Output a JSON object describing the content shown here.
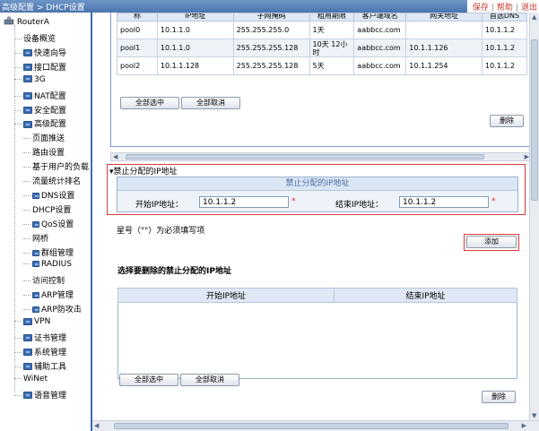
{
  "header": {
    "breadcrumb": "高级配置 > DHCP设置",
    "links": [
      "保存",
      "帮助",
      "退出"
    ]
  },
  "sidebar": {
    "root": "RouterA",
    "items": [
      {
        "label": "设备概览",
        "level": 1,
        "folder": false
      },
      {
        "label": "快速向导",
        "level": 1,
        "folder": true
      },
      {
        "label": "接口配置",
        "level": 1,
        "folder": true
      },
      {
        "label": "3G",
        "level": 1,
        "folder": true
      },
      {
        "label": "NAT配置",
        "level": 1,
        "folder": true
      },
      {
        "label": "安全配置",
        "level": 1,
        "folder": true
      },
      {
        "label": "高级配置",
        "level": 1,
        "folder": true
      },
      {
        "label": "页面推送",
        "level": 2,
        "folder": false
      },
      {
        "label": "路由设置",
        "level": 2,
        "folder": false
      },
      {
        "label": "基于用户的负载",
        "level": 2,
        "folder": false
      },
      {
        "label": "流量统计排名",
        "level": 2,
        "folder": false
      },
      {
        "label": "DNS设置",
        "level": 2,
        "folder": true
      },
      {
        "label": "DHCP设置",
        "level": 2,
        "folder": false
      },
      {
        "label": "QoS设置",
        "level": 2,
        "folder": true
      },
      {
        "label": "网桥",
        "level": 2,
        "folder": false
      },
      {
        "label": "群组管理",
        "level": 2,
        "folder": true
      },
      {
        "label": "RADIUS",
        "level": 2,
        "folder": true
      },
      {
        "label": "访问控制",
        "level": 2,
        "folder": false
      },
      {
        "label": "ARP管理",
        "level": 2,
        "folder": true
      },
      {
        "label": "ARP防攻击",
        "level": 2,
        "folder": true
      },
      {
        "label": "VPN",
        "level": 1,
        "folder": true
      },
      {
        "label": "证书管理",
        "level": 1,
        "folder": true
      },
      {
        "label": "系统管理",
        "level": 1,
        "folder": true
      },
      {
        "label": "辅助工具",
        "level": 1,
        "folder": true
      },
      {
        "label": "WiNet",
        "level": 1,
        "folder": false
      },
      {
        "label": "语音管理",
        "level": 1,
        "folder": true
      }
    ]
  },
  "pool_table": {
    "columns": [
      "称",
      "IP地址",
      "子网掩码",
      "租用期限",
      "客户端域名",
      "网关地址",
      "首选DNS"
    ],
    "rows": [
      [
        "pool0",
        "10.1.1.0",
        "255.255.255.0",
        "1天",
        "aabbcc.com",
        "",
        "10.1.1.2"
      ],
      [
        "pool1",
        "10.1.1.0",
        "255.255.255.128",
        "10天 12小时",
        "aabbcc.com",
        "10.1.1.126",
        "10.1.1.2"
      ],
      [
        "pool2",
        "10.1.1.128",
        "255.255.255.128",
        "5天",
        "aabbcc.com",
        "10.1.1.254",
        "10.1.1.2"
      ]
    ],
    "select_all": "全部选中",
    "deselect_all": "全部取消",
    "delete": "删除"
  },
  "forbid": {
    "section_title": "禁止分配的IP地址",
    "panel_title": "禁止分配的IP地址",
    "start_label": "开始IP地址：",
    "start_value": "10.1.1.2",
    "end_label": "结束IP地址：",
    "end_value": "10.1.1.2",
    "required_mark": "*",
    "note": "星号（\"\"）为必须填写项",
    "add": "添加"
  },
  "delete_section": {
    "title": "选择要删除的禁止分配的IP地址",
    "columns": [
      "开始IP地址",
      "结束IP地址"
    ],
    "select_all": "全部选中",
    "deselect_all": "全部取消",
    "delete": "删除"
  },
  "colors": {
    "accent": "#4a74ad",
    "highlight": "#d93a3a"
  }
}
